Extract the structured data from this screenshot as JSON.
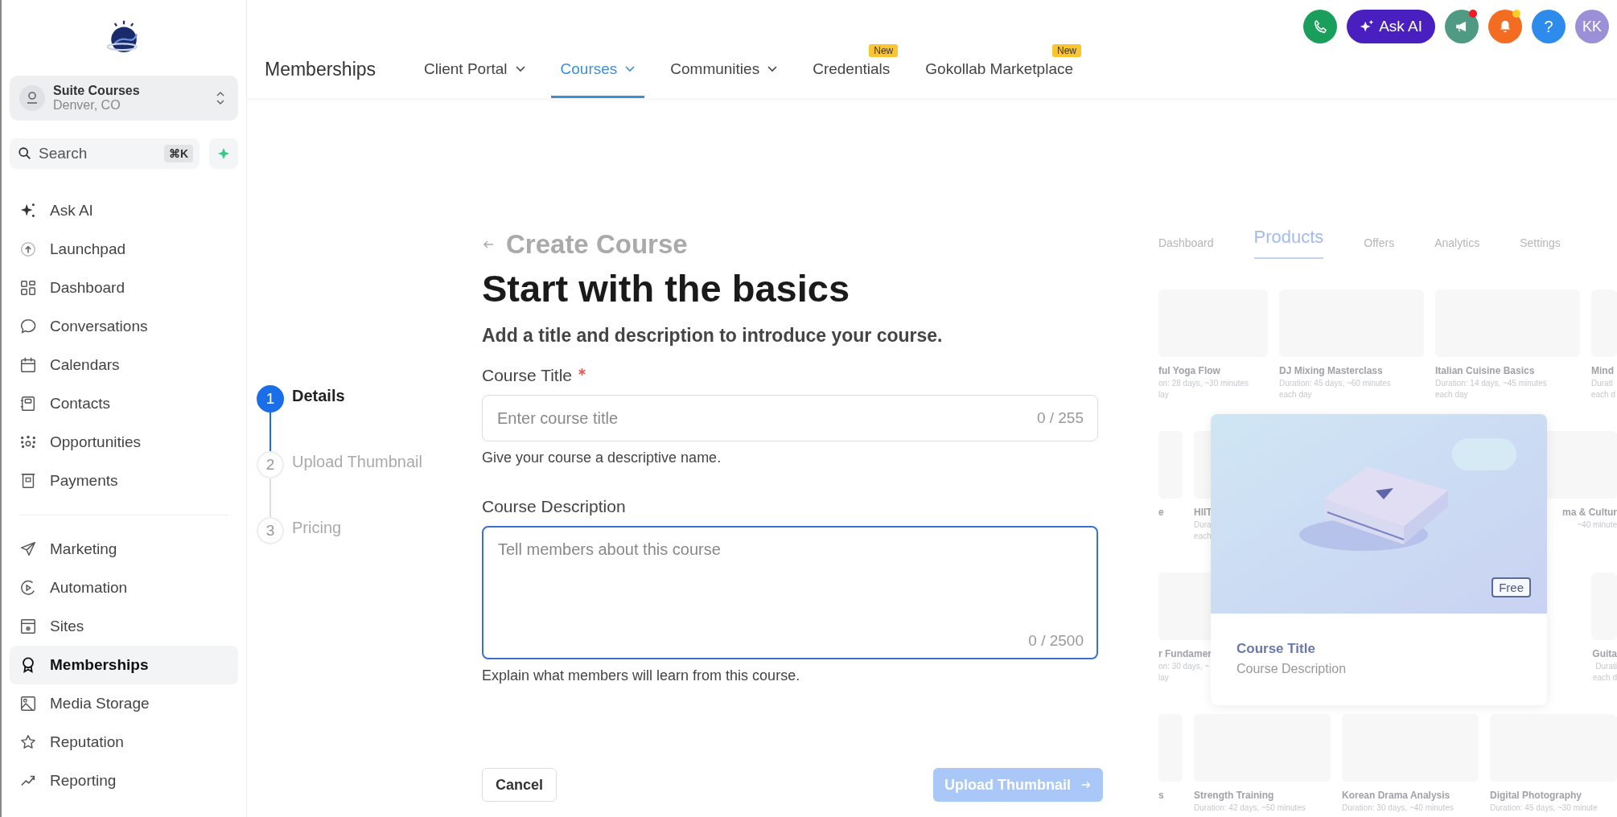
{
  "sidebar": {
    "account": {
      "name": "Suite Courses",
      "location": "Denver, CO"
    },
    "search": {
      "placeholder": "Search",
      "shortcut": "⌘K"
    },
    "sections": [
      {
        "items": [
          {
            "label": "Ask AI",
            "selected": false
          },
          {
            "label": "Launchpad",
            "selected": false
          },
          {
            "label": "Dashboard",
            "selected": false
          },
          {
            "label": "Conversations",
            "selected": false
          },
          {
            "label": "Calendars",
            "selected": false
          },
          {
            "label": "Contacts",
            "selected": false
          },
          {
            "label": "Opportunities",
            "selected": false
          },
          {
            "label": "Payments",
            "selected": false
          }
        ]
      },
      {
        "items": [
          {
            "label": "Marketing",
            "selected": false
          },
          {
            "label": "Automation",
            "selected": false
          },
          {
            "label": "Sites",
            "selected": false
          },
          {
            "label": "Memberships",
            "selected": true
          },
          {
            "label": "Media Storage",
            "selected": false
          },
          {
            "label": "Reputation",
            "selected": false
          },
          {
            "label": "Reporting",
            "selected": false
          }
        ]
      }
    ]
  },
  "header": {
    "title": "Memberships",
    "tabs": [
      {
        "label": "Client Portal",
        "selected": false,
        "dropdown": true
      },
      {
        "label": "Courses",
        "selected": true,
        "dropdown": true
      },
      {
        "label": "Communities",
        "selected": false,
        "dropdown": true
      },
      {
        "label": "Credentials",
        "selected": false,
        "dropdown": false,
        "badge": "New"
      },
      {
        "label": "Gokollab Marketplace",
        "selected": false,
        "dropdown": false,
        "badge": "New"
      }
    ],
    "actions": {
      "ask_ai": "Ask AI",
      "megaphone_dot": true,
      "bell_dot": true,
      "help": "?",
      "avatar": "KK"
    }
  },
  "stepper": [
    {
      "number": "1",
      "label": "Details",
      "selected": true
    },
    {
      "number": "2",
      "label": "Upload Thumbnail",
      "selected": false
    },
    {
      "number": "3",
      "label": "Pricing",
      "selected": false
    }
  ],
  "form": {
    "back": "Create Course",
    "heading": "Start with the basics",
    "subtitle": "Add a title and description to introduce your course.",
    "title_field": {
      "label": "Course Title",
      "required": true,
      "placeholder": "Enter course title",
      "counter": "0 / 255",
      "hint": "Give your course a descriptive name."
    },
    "description_field": {
      "label": "Course Description",
      "focused": true,
      "placeholder": "Tell members about this course",
      "counter": "0 / 2500",
      "hint": "Explain what members will learn from this course."
    },
    "buttons": {
      "cancel": "Cancel",
      "next": {
        "label": "Upload Thumbnail",
        "disabled": true
      }
    }
  },
  "preview": {
    "tabs": [
      {
        "label": "Dashboard",
        "selected": false
      },
      {
        "label": "Products",
        "selected": true
      },
      {
        "label": "Offers",
        "selected": false
      },
      {
        "label": "Analytics",
        "selected": false
      },
      {
        "label": "Settings",
        "selected": false
      }
    ],
    "rows": [
      {
        "shifted": false,
        "cells": [
          {
            "title": "ful Yoga Flow",
            "details": [
              "on: 28 days, ~30 minutes",
              "lay"
            ]
          },
          {
            "title": "DJ Mixing Masterclass",
            "details": [
              "Duration: 45 days, ~60 minutes",
              "each day"
            ]
          },
          {
            "title": "Italian Cuisine Basics",
            "details": [
              "Duration: 14 days, ~45 minutes",
              "each day"
            ]
          },
          {
            "title": "Mind",
            "details": [
              "Durati",
              "each d"
            ]
          }
        ]
      },
      {
        "shifted": true,
        "cells": [
          {
            "title": "e"
          },
          {
            "title": "HIIT",
            "details": [
              "Dura",
              "each"
            ]
          },
          {},
          {
            "title": "ma & Cultur",
            "details": [
              "~40 minute"
            ]
          }
        ]
      },
      {
        "shifted": false,
        "cells": [
          {
            "title": "r Fundamer",
            "details": [
              "on: 30 days, ~",
              "lay"
            ]
          },
          {},
          {},
          {
            "title": "Guita",
            "details": [
              "Durati",
              "each d"
            ]
          }
        ]
      },
      {
        "shifted": true,
        "cells": [
          {
            "title": "s"
          },
          {
            "title": "Strength Training",
            "details": [
              "Duration: 42 days, ~50 minutes"
            ]
          },
          {
            "title": "Korean Drama Analysis",
            "details": [
              "Duration: 30 days, ~40 minutes"
            ]
          },
          {
            "title": "Digital Photography",
            "details": [
              "Duration: 45 days, ~30 minute"
            ]
          }
        ]
      }
    ],
    "card": {
      "badge": "Free",
      "title": "Course Title",
      "description": "Course Description"
    }
  }
}
